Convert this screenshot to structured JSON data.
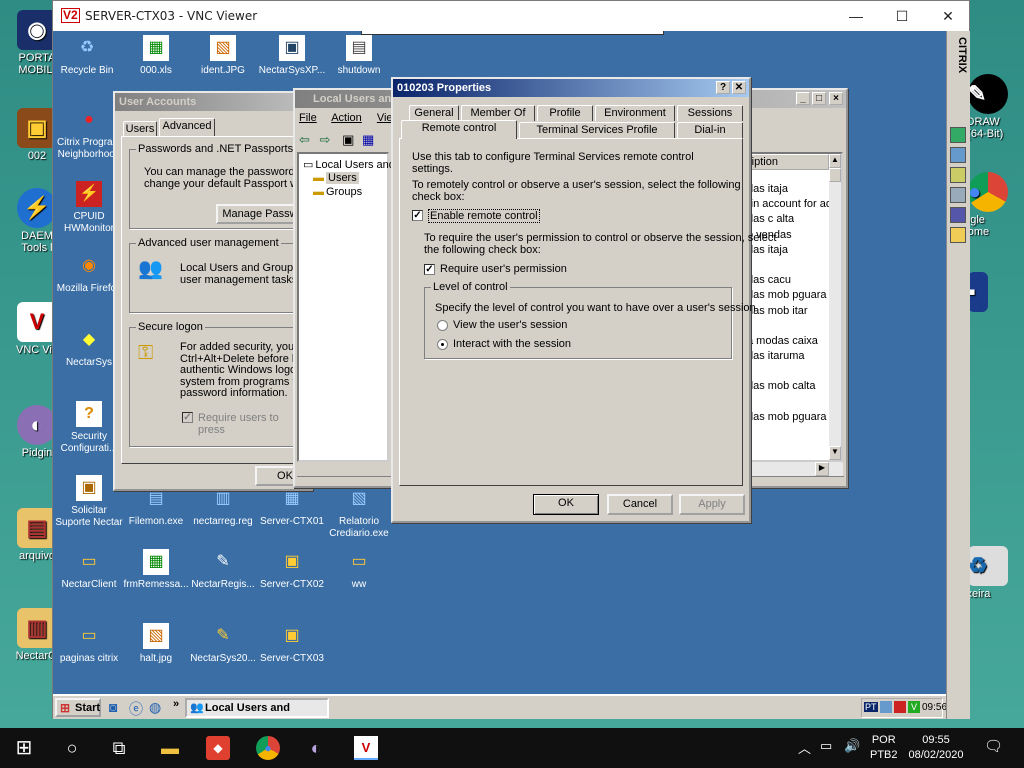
{
  "host_desktop": {
    "icons": [
      {
        "label": "PORTA\nMOBILI",
        "glyph": "◉"
      },
      {
        "label": "002",
        "glyph": "▣"
      },
      {
        "label": "DAEM\nTools l",
        "glyph": "⚡"
      },
      {
        "label": "VNC Vie",
        "glyph": "V"
      },
      {
        "label": "Pidgin",
        "glyph": "◐"
      },
      {
        "label": "arquivo",
        "glyph": "▤"
      },
      {
        "label": "NectarCl",
        "glyph": "▥"
      },
      {
        "label": "elDRAW\n3 (64-Bit)",
        "glyph": "✎"
      },
      {
        "label": "oogle\nhrome",
        "glyph": "●"
      },
      {
        "label": "o\no",
        "glyph": "▪"
      },
      {
        "label": "Lixeira",
        "glyph": "♻"
      }
    ]
  },
  "vnc": {
    "title": "SERVER-CTX03 - VNC Viewer",
    "logo": "V2",
    "minimize": "—",
    "maximize": "☐",
    "close": "✕",
    "sidebar_label": "CITRIX"
  },
  "remote_icons": [
    {
      "label": "Recycle Bin",
      "glyph": "♻"
    },
    {
      "label": "000.xls",
      "glyph": "▦"
    },
    {
      "label": "ident.JPG",
      "glyph": "▧"
    },
    {
      "label": "NectarSysXP...",
      "glyph": "▣"
    },
    {
      "label": "shutdown",
      "glyph": "▤"
    },
    {
      "label": "Citrix Program\nNeighborhood",
      "glyph": "●"
    },
    {
      "label": "CPUID\nHWMonitor",
      "glyph": "⚡"
    },
    {
      "label": "Mozilla Firefox",
      "glyph": "◉"
    },
    {
      "label": "NectarSys",
      "glyph": "◆"
    },
    {
      "label": "Security\nConfigurati...",
      "glyph": "?"
    },
    {
      "label": "Solicitar\nSuporte Nectar",
      "glyph": "▣"
    },
    {
      "label": "Filemon.exe",
      "glyph": "▤"
    },
    {
      "label": "nectarreg.reg",
      "glyph": "▥"
    },
    {
      "label": "Server-CTX01",
      "glyph": "▦"
    },
    {
      "label": "Relatorio\nCrediario.exe",
      "glyph": "▧"
    },
    {
      "label": "NectarClient",
      "glyph": "▭"
    },
    {
      "label": "frmRemessa...",
      "glyph": "▦"
    },
    {
      "label": "NectarRegis...",
      "glyph": "✎"
    },
    {
      "label": "Server-CTX02",
      "glyph": "▣"
    },
    {
      "label": "ww",
      "glyph": "▭"
    },
    {
      "label": "paginas citrix",
      "glyph": "▭"
    },
    {
      "label": "halt.jpg",
      "glyph": "▧"
    },
    {
      "label": "NectarSys20...",
      "glyph": "✎"
    },
    {
      "label": "Server-CTX03",
      "glyph": "▣"
    }
  ],
  "user_accounts": {
    "title": "User Accounts",
    "tabs": [
      "Users",
      "Advanced"
    ],
    "passports_legend": "Passwords and .NET Passports",
    "passports_text": "You can manage the passwords yo\nchange your default Passport with",
    "manage_btn": "Manage Passwo",
    "adv_legend": "Advanced user management",
    "adv_text": "Local Users and Groups ca\nuser management tasks.",
    "secure_legend": "Secure logon",
    "secure_text": "For added security, you ca\nCtrl+Alt+Delete before log\nauthentic Windows logon p\nsystem from programs tha\npassword information.",
    "require_label": "Require users to press",
    "ok": "OK"
  },
  "lusrmgr": {
    "title": "Local Users and G",
    "menu": [
      "File",
      "Action",
      "View"
    ],
    "tree": [
      "Local Users and G",
      "Users",
      "Groups"
    ],
    "col_header": "ription",
    "descriptions": [
      "das itaja",
      "-in account for adr",
      "das c alta",
      "o vendas",
      "das itaja",
      "",
      "das cacu",
      "das mob pguara",
      "das mob itar",
      "",
      "a modas caixa",
      "das itaruma",
      "",
      "das mob calta",
      "",
      "das mob pguara"
    ]
  },
  "props": {
    "title": "010203 Properties",
    "help": "?",
    "close": "✕",
    "tabs_row1": [
      "General",
      "Member Of",
      "Profile",
      "Environment",
      "Sessions"
    ],
    "tabs_row2": [
      "Remote control",
      "Terminal Services Profile",
      "Dial-in"
    ],
    "intro": "Use this tab to configure Terminal Services remote control settings.",
    "instr1": "To remotely control or observe a user's session, select the following\ncheck box:",
    "enable_label": "Enable remote control",
    "instr2": "To require the user's permission to control or observe the session, select\nthe following check box:",
    "require_label": "Require user's permission",
    "level_legend": "Level of control",
    "level_text": "Specify the level of control you want to have over a user's session",
    "radio_view": "View the user's session",
    "radio_interact": "Interact with the session",
    "ok": "OK",
    "cancel": "Cancel",
    "apply": "Apply"
  },
  "remote_taskbar": {
    "start": "Start",
    "task": "Local Users and Groups",
    "lang": "PT",
    "time": "09:56"
  },
  "host_taskbar": {
    "lang1": "POR",
    "lang2": "PTB2",
    "time": "09:55",
    "date": "08/02/2020"
  }
}
